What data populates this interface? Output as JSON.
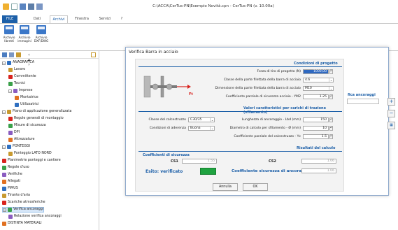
{
  "window": {
    "title": "C:\\ACCA\\CerTus-PN\\Esempio Novità.cpn - CerTus-PN (v. 10.00a)"
  },
  "tabs": [
    "FILE",
    "Dati",
    "Archivi",
    "Finestra",
    "Servizi",
    "?"
  ],
  "ribbon": {
    "buttons": [
      {
        "label1": "Archivio",
        "label2": "libretti"
      },
      {
        "label1": "Archivio",
        "label2": "immagini"
      },
      {
        "label1": "Archivio",
        "label2": "DXF/DWG"
      }
    ]
  },
  "tree": [
    {
      "label": "ANAGRAFICA",
      "level": 0,
      "exp": "−"
    },
    {
      "label": "Lavoro",
      "level": 1
    },
    {
      "label": "Committente",
      "level": 1
    },
    {
      "label": "Tecnici",
      "level": 1
    },
    {
      "label": "Imprese",
      "level": 1,
      "exp": "−"
    },
    {
      "label": "Montatrice",
      "level": 2
    },
    {
      "label": "Utilizzatrici",
      "level": 2
    },
    {
      "label": "Piano di applicazione generalizzata",
      "level": 0,
      "exp": "−"
    },
    {
      "label": "Regole generali di montaggio",
      "level": 1
    },
    {
      "label": "Misure di sicurezza",
      "level": 1
    },
    {
      "label": "DPI",
      "level": 1
    },
    {
      "label": "Attrezzature",
      "level": 1
    },
    {
      "label": "PONTEGGI",
      "level": 0,
      "exp": "−"
    },
    {
      "label": "Ponteggio LATO NORD",
      "level": 1
    },
    {
      "label": "Planimetrie ponteggi e cantiere",
      "level": 0
    },
    {
      "label": "Regole d'uso",
      "level": 0
    },
    {
      "label": "Verifiche",
      "level": 0
    },
    {
      "label": "Allegati",
      "level": 0
    },
    {
      "label": "PiMUS",
      "level": 0
    },
    {
      "label": "Tirante d'aria",
      "level": 0
    },
    {
      "label": "Scariche atmosferiche",
      "level": 0
    },
    {
      "label": "Verifica ancoraggi",
      "level": 0,
      "exp": "−",
      "selected": true
    },
    {
      "label": "Relazione verifica ancoraggi",
      "level": 1
    },
    {
      "label": "DISTINTA MATERIALI",
      "level": 0
    }
  ],
  "dialog": {
    "title": "Verifica Barra in acciaio",
    "section1": "Condizioni di progetto",
    "forza_label": "Forza di tiro di progetto (N)",
    "forza_value": "1000,00",
    "classe_filettata_label": "Classe della parte filettata della barra di acciaio",
    "classe_filettata_value": "4.6",
    "dimensione_label": "Dimensione della parte filettata della barra di acciaio",
    "dimensione_value": "M10",
    "coeff_m2_label": "Coefficiente parziale di sicurezza acciaio - YM2",
    "coeff_m2_value": "1.25",
    "diagram_label": "Ft",
    "section2": "Valori caratteristici per carichi di trazione (sfilamento)",
    "classe_cls_label": "Classe del calcestruzzo",
    "classe_cls_value": "C30/35",
    "aderenza_label": "Condizioni di aderenza",
    "aderenza_value": "Buona",
    "lunghezza_label": "Lunghezza di ancoraggio - Lbd (mm)",
    "lunghezza_value": "150",
    "diametro_label": "Diametro di calcolo per sfilamento - Ø (mm)",
    "diametro_value": "10",
    "coeff_c_label": "Coefficiente parziale del calcestruzzo - Yc",
    "coeff_c_value": "1.5",
    "section3": "Risultati del calcolo",
    "coeff_sic_title": "Coefficienti di sicurezza",
    "cs1_label": "CS1",
    "cs1_value": "1.55",
    "cs2_label": "CS2",
    "cs2_value": "1.06",
    "esito_label": "Esito: verificato",
    "esito_color": "#1fa340",
    "cs_anc_label": "Coefficiente sicurezza di ancoraggio CS",
    "cs_anc_value": "1.06",
    "annulla": "Annulla",
    "ok": "OK"
  },
  "right_panel": {
    "title": "fica ancoraggi",
    "plus": "+",
    "minus": "−"
  },
  "colors": {
    "accent": "#1c5fa8",
    "ok_green": "#1fa340",
    "arrow_red": "#d8231e"
  }
}
